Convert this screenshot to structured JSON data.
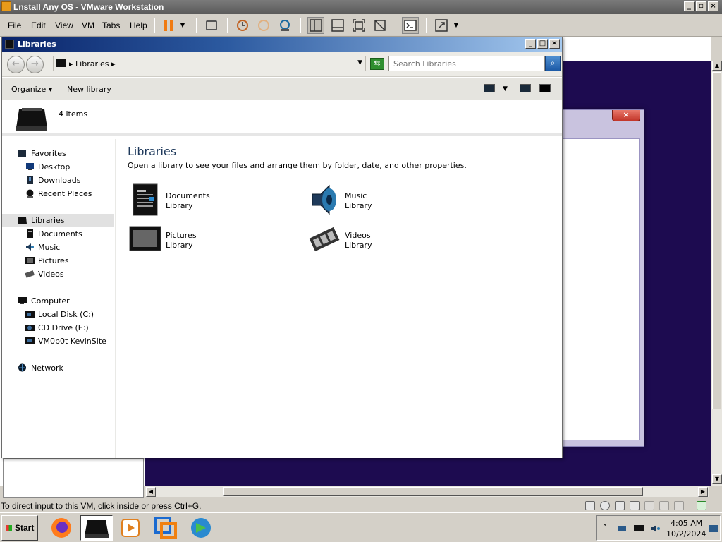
{
  "vmware": {
    "title": "Lnstall Any OS - VMware Workstation",
    "menu": [
      "File",
      "Edit",
      "View",
      "VM",
      "Tabs",
      "Help"
    ],
    "status_text": "To direct input to this VM, click inside or press Ctrl+G."
  },
  "explorer": {
    "title": "Libraries",
    "address": "Libraries",
    "search_placeholder": "Search Libraries",
    "toolbar": {
      "organize": "Organize",
      "new_library": "New library"
    },
    "item_count": "4 items",
    "heading": "Libraries",
    "subheading": "Open a library to see your files and arrange them by folder, date, and other properties.",
    "nav": {
      "favorites": {
        "label": "Favorites",
        "items": [
          "Desktop",
          "Downloads",
          "Recent Places"
        ]
      },
      "libraries": {
        "label": "Libraries",
        "items": [
          "Documents",
          "Music",
          "Pictures",
          "Videos"
        ]
      },
      "computer": {
        "label": "Computer",
        "items": [
          "Local Disk (C:)",
          "CD Drive (E:)",
          "VM0b0t KevinSite"
        ]
      },
      "network": {
        "label": "Network"
      }
    },
    "libraries": [
      {
        "name": "Documents",
        "type": "Library",
        "icon": "documents-icon"
      },
      {
        "name": "Music",
        "type": "Library",
        "icon": "music-icon"
      },
      {
        "name": "Pictures",
        "type": "Library",
        "icon": "pictures-icon"
      },
      {
        "name": "Videos",
        "type": "Library",
        "icon": "videos-icon"
      }
    ]
  },
  "taskbar": {
    "start": "Start",
    "time": "4:05 AM",
    "date": "10/2/2024"
  },
  "colors": {
    "guest_bg": "#1d0b50",
    "title_active": "#0a246a"
  }
}
